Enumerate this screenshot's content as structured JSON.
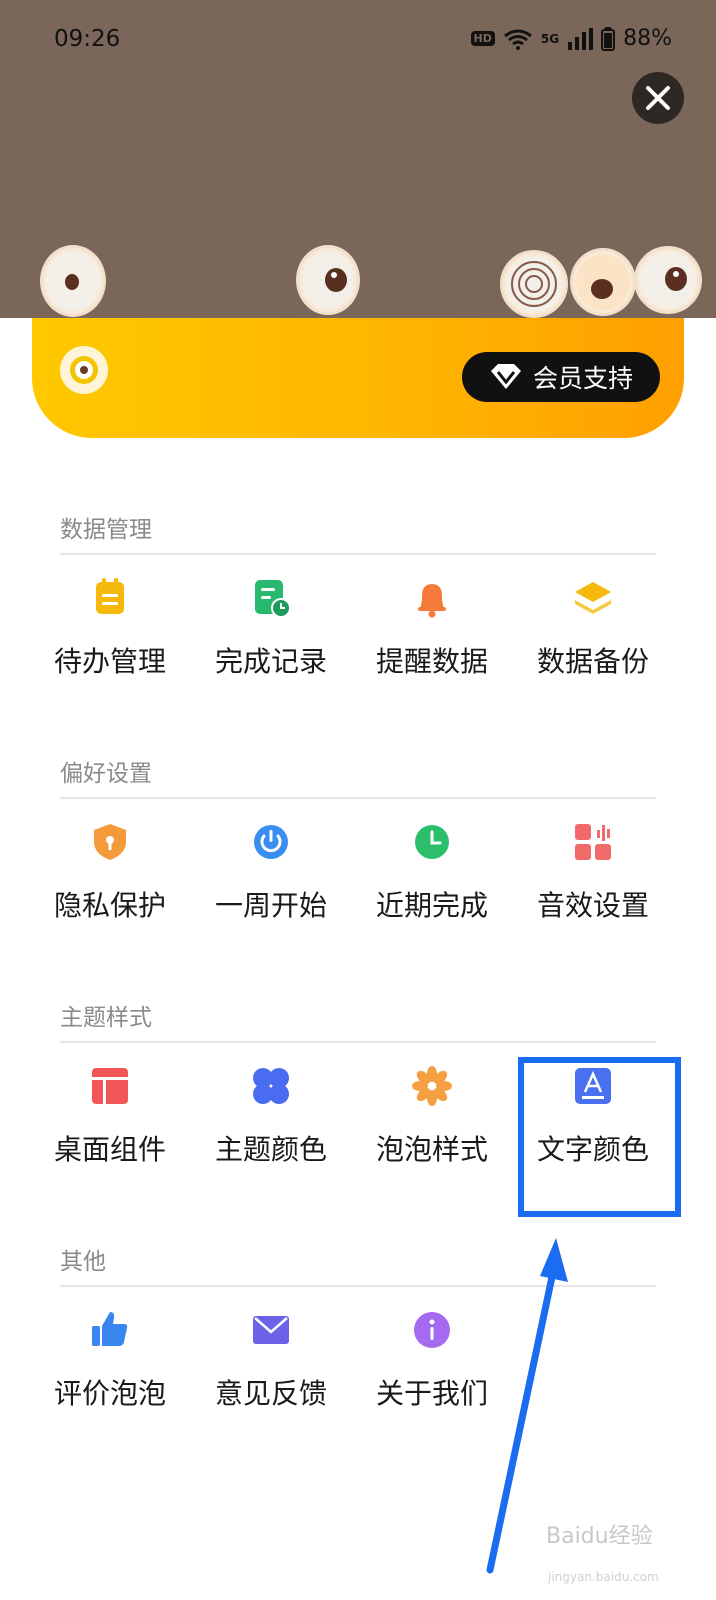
{
  "status_bar": {
    "time": "09:26",
    "hd": "HD",
    "network": "5G",
    "battery": "88%"
  },
  "banner": {
    "member_button_label": "会员支持"
  },
  "sections": [
    {
      "title": "数据管理",
      "items": [
        {
          "label": "待办管理",
          "icon": "todo-icon"
        },
        {
          "label": "完成记录",
          "icon": "completion-record-icon"
        },
        {
          "label": "提醒数据",
          "icon": "bell-icon"
        },
        {
          "label": "数据备份",
          "icon": "layers-icon"
        }
      ]
    },
    {
      "title": "偏好设置",
      "items": [
        {
          "label": "隐私保护",
          "icon": "shield-icon"
        },
        {
          "label": "一周开始",
          "icon": "power-icon"
        },
        {
          "label": "近期完成",
          "icon": "clock-icon"
        },
        {
          "label": "音效设置",
          "icon": "sound-grid-icon"
        }
      ]
    },
    {
      "title": "主题样式",
      "items": [
        {
          "label": "桌面组件",
          "icon": "widget-icon"
        },
        {
          "label": "主题颜色",
          "icon": "clover-icon"
        },
        {
          "label": "泡泡样式",
          "icon": "flower-icon"
        },
        {
          "label": "文字颜色",
          "icon": "text-color-icon"
        }
      ]
    },
    {
      "title": "其他",
      "items": [
        {
          "label": "评价泡泡",
          "icon": "thumbs-up-icon"
        },
        {
          "label": "意见反馈",
          "icon": "mail-icon"
        },
        {
          "label": "关于我们",
          "icon": "info-icon"
        }
      ]
    }
  ],
  "colors": {
    "top_background": "#7a6759",
    "banner_gradient": [
      "#ffc800",
      "#ff9f00"
    ],
    "highlight": "#1a6df0"
  },
  "watermark": {
    "text": "Baidu经验",
    "sub": "jingyan.baidu.com"
  }
}
